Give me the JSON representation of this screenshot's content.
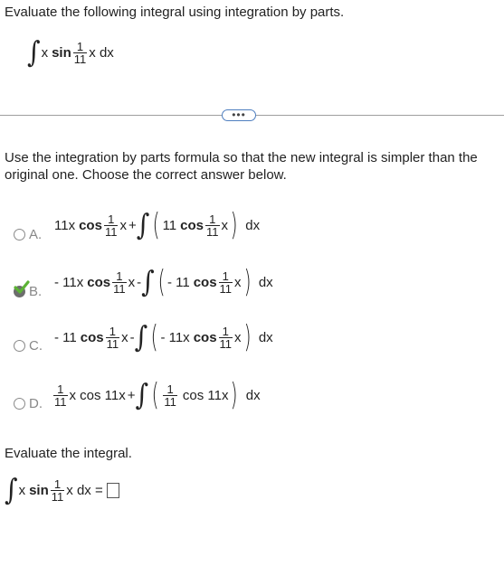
{
  "question": {
    "prompt": "Evaluate the following integral using integration by parts.",
    "integrand_prefix": "x",
    "trig": "sin",
    "frac_num": "1",
    "frac_den": "11",
    "integrand_suffix": "x dx"
  },
  "more_button": {
    "label": "•••"
  },
  "instructions": "Use the integration by parts formula so that the new integral is simpler than the original one. Choose the correct answer below.",
  "options": [
    {
      "letter": "A.",
      "selected": false,
      "coef": "11x",
      "trig1": "cos",
      "num1": "1",
      "den1": "11",
      "var1": "x",
      "op": "+",
      "inner_coef": "11",
      "trig2": "cos",
      "num2": "1",
      "den2": "11",
      "var2": "x",
      "dx": "dx"
    },
    {
      "letter": "B.",
      "selected": true,
      "coef": "- 11x",
      "trig1": "cos",
      "num1": "1",
      "den1": "11",
      "var1": "x",
      "op": "-",
      "inner_coef": "- 11",
      "trig2": "cos",
      "num2": "1",
      "den2": "11",
      "var2": "x",
      "dx": "dx"
    },
    {
      "letter": "C.",
      "selected": false,
      "coef": "- 11",
      "trig1": "cos",
      "num1": "1",
      "den1": "11",
      "var1": "x",
      "op": "-",
      "inner_coef": "- 11x",
      "trig2": "cos",
      "num2": "1",
      "den2": "11",
      "var2": "x",
      "dx": "dx"
    },
    {
      "letter": "D.",
      "selected": false,
      "lead_num": "1",
      "lead_den": "11",
      "lead_rest": "x cos 11x",
      "op": "+",
      "inner_num": "1",
      "inner_den": "11",
      "inner_rest": "cos 11x",
      "dx": "dx"
    }
  ],
  "evaluate": {
    "prompt": "Evaluate the integral.",
    "integrand_prefix": "x",
    "trig": "sin",
    "frac_num": "1",
    "frac_den": "11",
    "integrand_suffix": "x dx ="
  },
  "colors": {
    "check": "#5cb335",
    "selected_radio": "#6d6d6d",
    "more_border": "#4f7fc0"
  },
  "icons": {
    "selected_mark": "check-icon"
  }
}
